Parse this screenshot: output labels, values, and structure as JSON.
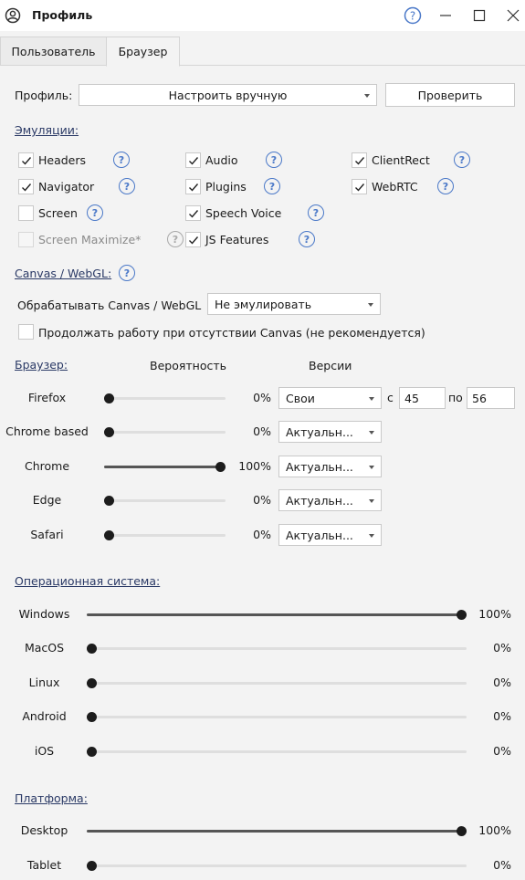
{
  "window": {
    "title": "Профиль",
    "icons": {
      "app": "user-circle-icon",
      "help": "help-icon",
      "minimize": "minimize-icon",
      "maximize": "maximize-icon",
      "close": "close-icon"
    }
  },
  "tabs": [
    {
      "label": "Пользователь",
      "active": false
    },
    {
      "label": "Браузер",
      "active": true
    }
  ],
  "profile": {
    "label": "Профиль:",
    "select_value": "Настроить вручную",
    "check_button": "Проверить"
  },
  "emulation": {
    "title": "Эмуляции:",
    "items": [
      {
        "label": "Headers",
        "checked": true,
        "enabled": true
      },
      {
        "label": "Audio",
        "checked": true,
        "enabled": true
      },
      {
        "label": "ClientRect",
        "checked": true,
        "enabled": true
      },
      {
        "label": "Navigator",
        "checked": true,
        "enabled": true
      },
      {
        "label": "Plugins",
        "checked": true,
        "enabled": true
      },
      {
        "label": "WebRTC",
        "checked": true,
        "enabled": true
      },
      {
        "label": "Screen",
        "checked": false,
        "enabled": true
      },
      {
        "label": "Speech Voice",
        "checked": true,
        "enabled": true
      },
      {
        "label": "Screen Maximize*",
        "checked": false,
        "enabled": false
      },
      {
        "label": "JS Features",
        "checked": true,
        "enabled": true
      }
    ]
  },
  "canvas": {
    "title": "Canvas / WebGL:",
    "process_label": "Обрабатывать Canvas / WebGL",
    "process_value": "Не эмулировать",
    "continue_label": "Продолжать работу при отсутствии Canvas (не рекомендуется)",
    "continue_checked": false
  },
  "browser": {
    "title": "Браузер:",
    "probability_header": "Вероятность",
    "versions_header": "Версии",
    "from_label": "с",
    "to_label": "по",
    "rows": [
      {
        "name": "Firefox",
        "value": 0,
        "display": "0%",
        "version": "Свои",
        "from": "45",
        "to": "56"
      },
      {
        "name": "Chrome based",
        "value": 0,
        "display": "0%",
        "version": "Актуальн..."
      },
      {
        "name": "Chrome",
        "value": 100,
        "display": "100%",
        "version": "Актуальн..."
      },
      {
        "name": "Edge",
        "value": 0,
        "display": "0%",
        "version": "Актуальн..."
      },
      {
        "name": "Safari",
        "value": 0,
        "display": "0%",
        "version": "Актуальн..."
      }
    ]
  },
  "os": {
    "title": "Операционная система:",
    "rows": [
      {
        "name": "Windows",
        "value": 100,
        "display": "100%"
      },
      {
        "name": "MacOS",
        "value": 0,
        "display": "0%"
      },
      {
        "name": "Linux",
        "value": 0,
        "display": "0%"
      },
      {
        "name": "Android",
        "value": 0,
        "display": "0%"
      },
      {
        "name": "iOS",
        "value": 0,
        "display": "0%"
      }
    ]
  },
  "platform": {
    "title": "Платформа:",
    "rows": [
      {
        "name": "Desktop",
        "value": 100,
        "display": "100%"
      },
      {
        "name": "Tablet",
        "value": 0,
        "display": "0%"
      }
    ]
  },
  "colors": {
    "accent": "#4a78c8",
    "section_text": "#2b3a66",
    "track": "#dedede",
    "thumb": "#1c1c1c"
  }
}
